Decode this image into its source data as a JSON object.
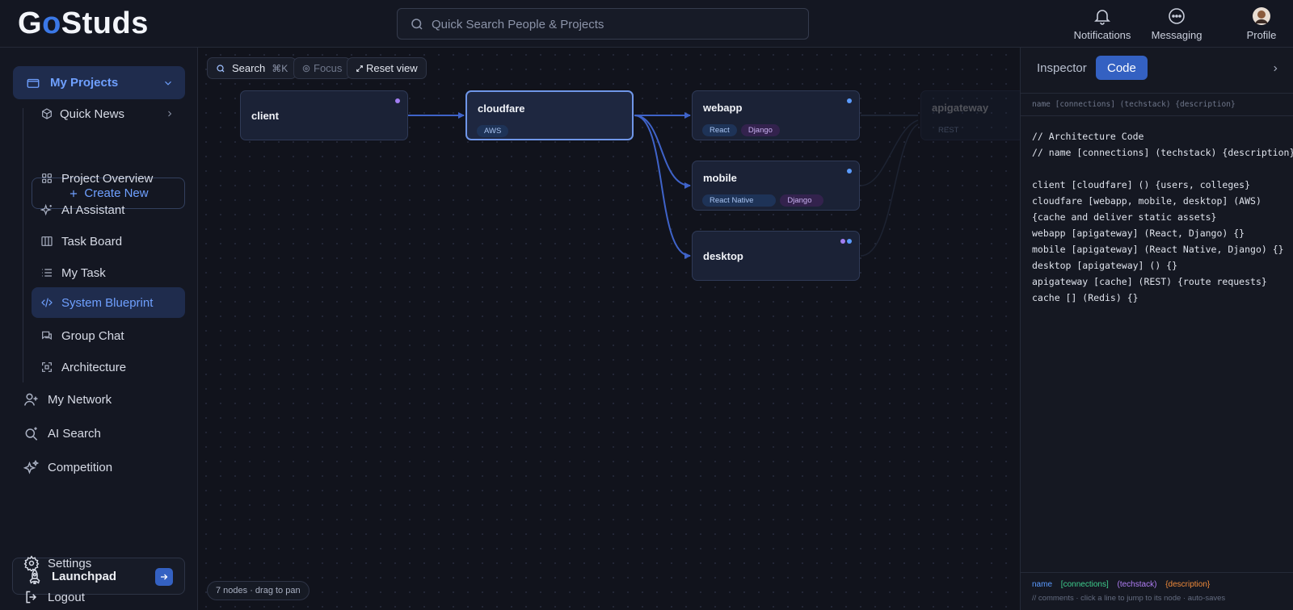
{
  "header": {
    "logo": {
      "part1": "G",
      "part2": "o",
      "part3": "Studs"
    },
    "search_placeholder": "Quick Search People & Projects",
    "nav": {
      "notifications": "Notifications",
      "messaging": "Messaging",
      "profile": "Profile"
    }
  },
  "sidebar": {
    "my_projects": "My Projects",
    "quick_news": "Quick News",
    "create_new": "Create New",
    "sub_items": [
      {
        "label": "Project Overview",
        "icon": "grid-icon"
      },
      {
        "label": "AI Assistant",
        "icon": "sparkle-icon"
      },
      {
        "label": "Task Board",
        "icon": "columns-icon"
      },
      {
        "label": "My Task",
        "icon": "list-icon"
      },
      {
        "label": "System Blueprint",
        "icon": "code-icon"
      },
      {
        "label": "Group Chat",
        "icon": "chat-icon"
      },
      {
        "label": "Architecture",
        "icon": "expand-icon"
      }
    ],
    "my_network": "My Network",
    "ai_search": "AI Search",
    "competition": "Competition",
    "launchpad": "Launchpad",
    "settings": "Settings",
    "logout": "Logout"
  },
  "canvas": {
    "toolbar": {
      "search": "Search",
      "search_shortcut": "⌘K",
      "focus": "Focus",
      "reset": "Reset view"
    },
    "nodes": [
      {
        "name": "client",
        "tags": []
      },
      {
        "name": "cloudfare",
        "tags": [
          "AWS"
        ]
      },
      {
        "name": "webapp",
        "tags": [
          "React",
          "Django"
        ]
      },
      {
        "name": "mobile",
        "tags": [
          "React Native",
          "Django"
        ]
      },
      {
        "name": "desktop",
        "tags": []
      },
      {
        "name": "apigateway",
        "tags": [
          "REST"
        ]
      }
    ],
    "footer": "7 nodes · drag to pan"
  },
  "panel": {
    "tabs": {
      "inspector": "Inspector",
      "code": "Code"
    },
    "syntax": "name [connections] (techstack) {description}",
    "code_lines": [
      "// Architecture Code",
      "// name [connections] (techstack) {description}",
      "",
      "client [cloudfare] () {users, colleges}",
      "cloudfare [webapp, mobile, desktop] (AWS)",
      "{cache and deliver static assets}",
      "webapp [apigateway] (React, Django) {}",
      "mobile [apigateway] (React Native, Django) {}",
      "desktop [apigateway] () {}",
      "apigateway [cache] (REST) {route requests}",
      "cache [] (Redis) {}"
    ],
    "legend": {
      "name": "name",
      "connections": "[connections]",
      "techstack": "(techstack)",
      "description": "{description}",
      "hint": "// comments · click a line to jump to its node · auto-saves"
    }
  },
  "colors": {
    "accent": "#3b78e7",
    "active_bg": "#1f2c4d",
    "legend_name": "#5b9bff",
    "legend_connections": "#3ecf8e",
    "legend_techstack": "#b07ef5",
    "legend_description": "#f08a3a"
  }
}
